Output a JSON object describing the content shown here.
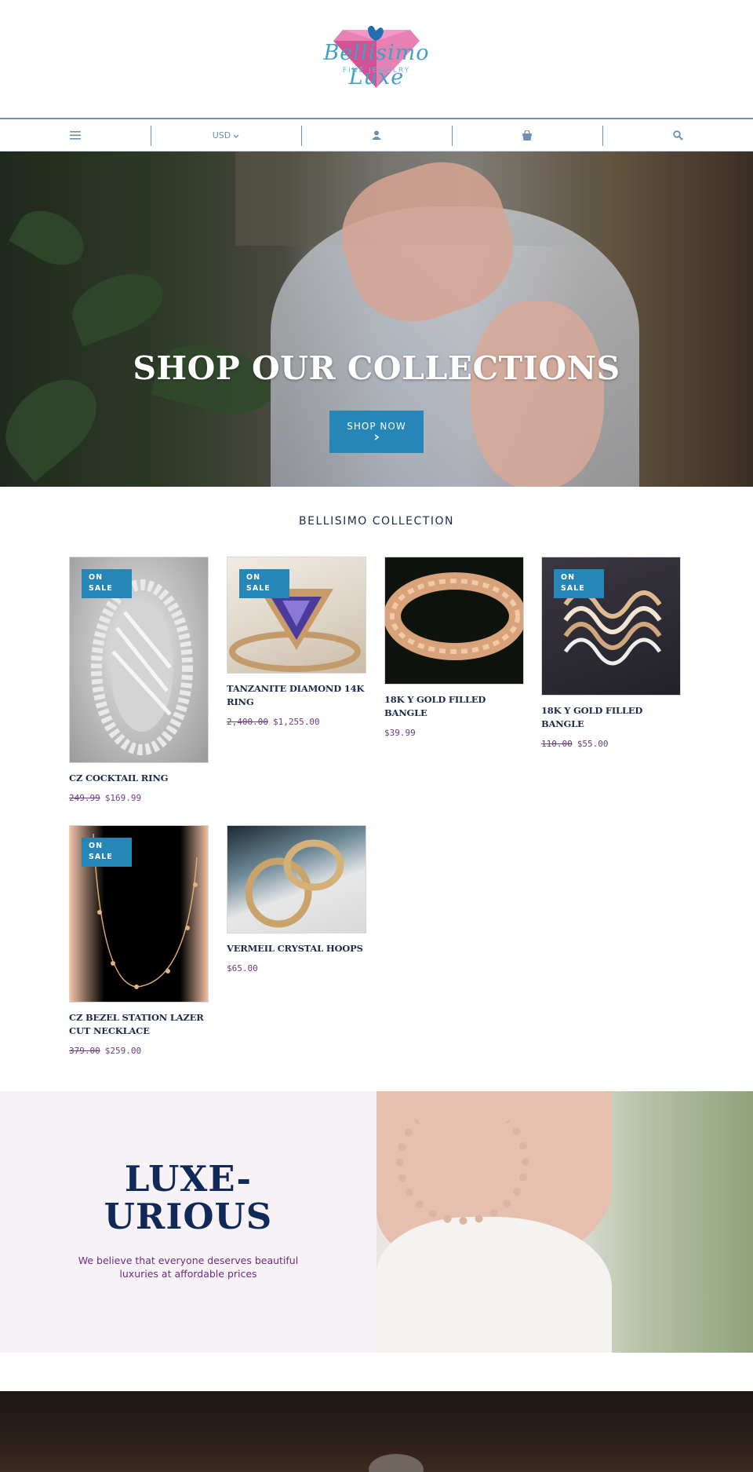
{
  "brand": {
    "logo_name": "Bellisimo Luxe",
    "logo_sub": "FINE JEWELRY",
    "colors": {
      "accent": "#2586b7",
      "navy": "#1a2b4c",
      "price": "#6d3b7e",
      "nav": "#6d8fb0"
    }
  },
  "nav": {
    "menu_icon": "hamburger-icon",
    "currency": "USD",
    "account_icon": "user-icon",
    "cart_icon": "bag-icon",
    "search_icon": "search-icon"
  },
  "hero": {
    "title": "SHOP OUR COLLECTIONS",
    "button_label": "SHOP NOW"
  },
  "collection": {
    "title": "BELLISIMO COLLECTION",
    "badge_line1": "ON",
    "badge_line2": "SALE",
    "products": [
      {
        "name": "CZ COCKTAIL RING",
        "old_price": "249.99",
        "price": "$169.99",
        "on_sale": true
      },
      {
        "name": "TANZANITE DIAMOND 14K RING",
        "old_price": "2,400.00",
        "price": "$1,255.00",
        "on_sale": true
      },
      {
        "name": "18K Y GOLD FILLED BANGLE",
        "old_price": "",
        "price": "$39.99",
        "on_sale": false
      },
      {
        "name": "18K Y GOLD FILLED BANGLE",
        "old_price": "110.00",
        "price": "$55.00",
        "on_sale": true
      },
      {
        "name": "CZ BEZEL STATION LAZER CUT NECKLACE",
        "old_price": "379.00",
        "price": "$259.00",
        "on_sale": true
      },
      {
        "name": "VERMEIL CRYSTAL HOOPS",
        "old_price": "",
        "price": "$65.00",
        "on_sale": false
      }
    ]
  },
  "luxe": {
    "title_line1": "LUXE-",
    "title_line2": "URIOUS",
    "text": "We believe that everyone deserves beautiful luxuries at affordable prices"
  }
}
